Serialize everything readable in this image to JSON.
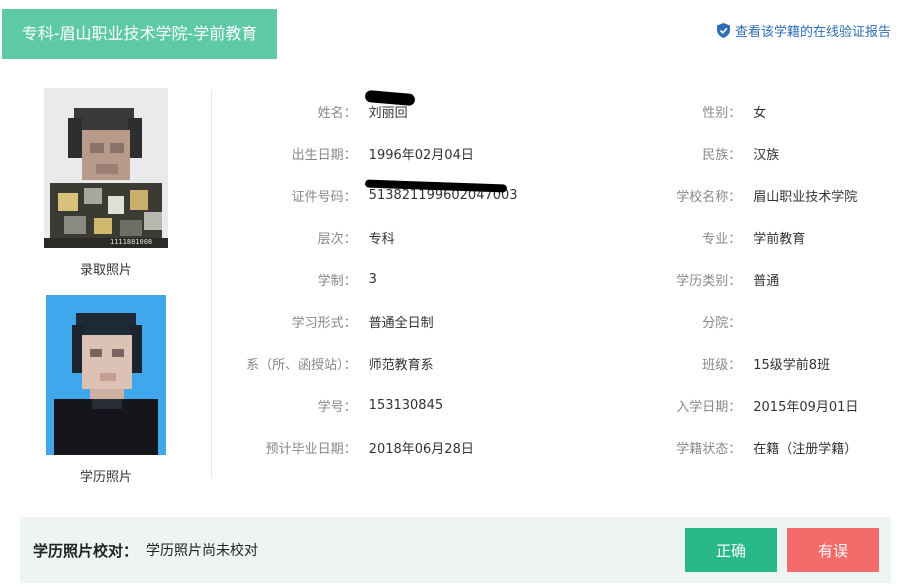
{
  "header": {
    "title": "专科-眉山职业技术学院-学前教育"
  },
  "verify_link": {
    "label": "查看该学籍的在线验证报告"
  },
  "photos": {
    "admission_caption": "录取照片",
    "edu_caption": "学历照片",
    "admission_stamp": "1111881008"
  },
  "info": {
    "rows": [
      {
        "l_label": "姓名：",
        "l_value": "刘丽回",
        "r_label": "性别：",
        "r_value": "女"
      },
      {
        "l_label": "出生日期：",
        "l_value": "1996年02月04日",
        "r_label": "民族：",
        "r_value": "汉族"
      },
      {
        "l_label": "证件号码：",
        "l_value": "513821199602047003",
        "r_label": "学校名称：",
        "r_value": "眉山职业技术学院"
      },
      {
        "l_label": "层次：",
        "l_value": "专科",
        "r_label": "专业：",
        "r_value": "学前教育"
      },
      {
        "l_label": "学制：",
        "l_value": "3",
        "r_label": "学历类别：",
        "r_value": "普通"
      },
      {
        "l_label": "学习形式：",
        "l_value": "普通全日制",
        "r_label": "分院：",
        "r_value": ""
      },
      {
        "l_label": "系（所、函授站）：",
        "l_value": "师范教育系",
        "r_label": "班级：",
        "r_value": "15级学前8班"
      },
      {
        "l_label": "学号：",
        "l_value": "153130845",
        "r_label": "入学日期：",
        "r_value": "2015年09月01日"
      },
      {
        "l_label": "预计毕业日期：",
        "l_value": "2018年06月28日",
        "r_label": "学籍状态：",
        "r_value": "在籍（注册学籍）"
      }
    ]
  },
  "photo_check": {
    "label": "学历照片校对：",
    "value": "学历照片尚未校对",
    "correct_button": "正确",
    "wrong_button": "有误"
  },
  "colors": {
    "header_bg": "#5dc9a6",
    "link": "#2c6db6",
    "correct": "#29b888",
    "wrong": "#f46b6b"
  }
}
